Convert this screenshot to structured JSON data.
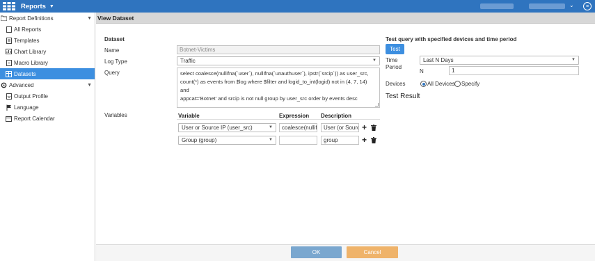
{
  "app": {
    "title": "Reports",
    "accent": "#2f74bf",
    "icons": {
      "logo": "grid-logo-icon",
      "menu": "chevron-down-icon",
      "settings": "gear-icon"
    }
  },
  "sidebar": {
    "groups": [
      {
        "label": "Report Definitions",
        "icon": "folder-icon",
        "expanded": true,
        "items": [
          {
            "label": "All Reports",
            "icon": "document-icon"
          },
          {
            "label": "Templates",
            "icon": "template-icon"
          },
          {
            "label": "Chart Library",
            "icon": "chart-icon"
          },
          {
            "label": "Macro Library",
            "icon": "macro-icon"
          },
          {
            "label": "Datasets",
            "icon": "datasets-icon",
            "active": true
          }
        ]
      },
      {
        "label": "Advanced",
        "icon": "gear-icon",
        "expanded": true,
        "items": [
          {
            "label": "Output Profile",
            "icon": "output-icon"
          },
          {
            "label": "Language",
            "icon": "flag-icon"
          },
          {
            "label": "Report Calendar",
            "icon": "calendar-icon"
          }
        ]
      }
    ]
  },
  "main": {
    "header": "View Dataset",
    "section_label": "Dataset",
    "name_label": "Name",
    "name_value": "Botnet-Victims",
    "log_type_label": "Log Type",
    "log_type_value": "Traffic",
    "query_label": "Query",
    "query_lines": [
      "select coalesce(nullifna(`user`), nullifna(`unauthuser`), ipstr(`srcip`)) as user_src,",
      "count(*) as events from $log where $filter and logid_to_int(logid) not in (4, 7, 14) and",
      "appcat='Botnet' and srcip is not null group by user_src order by events desc"
    ],
    "variables_label": "Variables",
    "variables_columns": {
      "variable": "Variable",
      "expression": "Expression",
      "description": "Description"
    },
    "variables": [
      {
        "variable": "User or Source IP (user_src)",
        "expression": "coalesce(nullif",
        "description": "User (or Sourc"
      },
      {
        "variable": "Group (group)",
        "expression": "",
        "description": "group"
      }
    ]
  },
  "test_panel": {
    "title": "Test query with specified devices and time period",
    "test_button": "Test",
    "time_period_label_1": "Time",
    "time_period_label_2": "Period",
    "time_period_value": "Last N Days",
    "n_label": "N",
    "n_value": "1",
    "devices_label": "Devices",
    "all_devices": "All Devices",
    "specify": "Specify",
    "devices_selected": "all",
    "test_result_label": "Test Result"
  },
  "footer": {
    "ok": "OK",
    "cancel": "Cancel",
    "ok_color": "#7aa7cf",
    "cancel_color": "#efb36a"
  }
}
